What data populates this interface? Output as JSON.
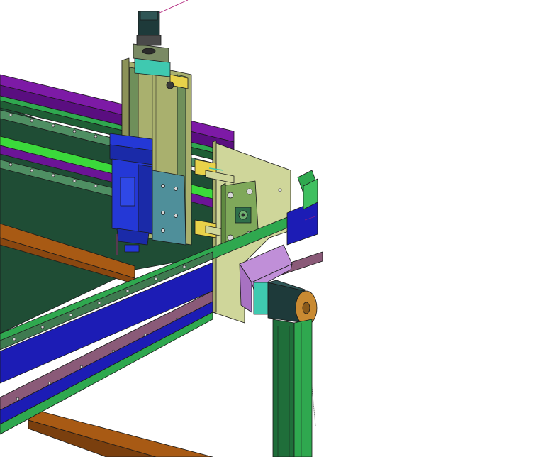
{
  "view": {
    "background": "#ffffff"
  },
  "colors": {
    "purple_rail": "#7d1aa6",
    "purple_dark": "#4a0a70",
    "green_rail": "#2fa84f",
    "green_bright": "#3bd93b",
    "green_dark": "#1f5e35",
    "blue_beam": "#1c1cb5",
    "blue_spindle": "#2438d6",
    "orange_frame": "#a85a14",
    "olive_plate": "#cfd69a",
    "olive_carriage": "#a9b06e",
    "teal_block": "#3fc9b0",
    "yellow_part": "#e8d24a",
    "lavender_mount": "#c08fd8",
    "motor_dark": "#1e3a3a",
    "motor_flange": "#c98a32",
    "rack_mauve": "#8a5a78",
    "leg_green": "#1f6e3a"
  },
  "icons": {
    "stepper_motor_z": "stepper-motor",
    "stepper_motor_x": "stepper-motor",
    "spindle": "spindle-motor"
  }
}
